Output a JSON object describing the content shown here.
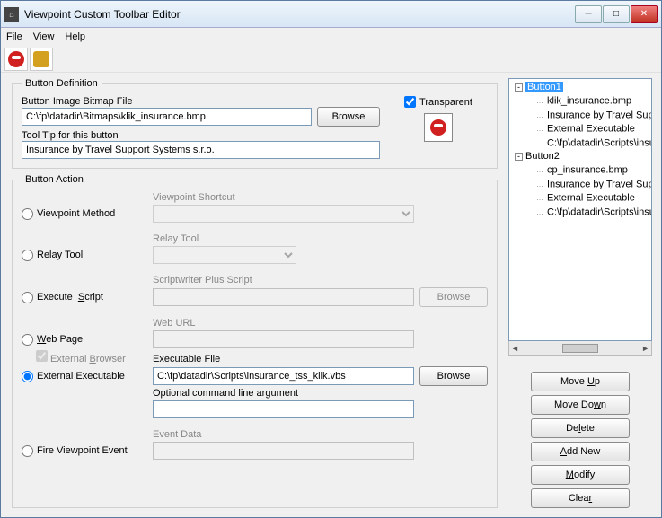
{
  "window": {
    "title": "Viewpoint Custom Toolbar Editor"
  },
  "menu": {
    "file": "File",
    "view": "View",
    "help": "Help"
  },
  "definition": {
    "legend": "Button Definition",
    "bitmap_label": "Button Image Bitmap File",
    "bitmap_value": "C:\\fp\\datadir\\Bitmaps\\klik_insurance.bmp",
    "browse": "Browse",
    "transparent_label": "Transparent",
    "transparent_checked": true,
    "tooltip_label": "Tool Tip for this button",
    "tooltip_value": "Insurance by Travel Support Systems s.r.o."
  },
  "action": {
    "legend": "Button Action",
    "viewpoint_method": "Viewpoint Method",
    "viewpoint_shortcut_label": "Viewpoint Shortcut",
    "relay_tool": "Relay Tool",
    "relay_tool_label": "Relay Tool",
    "execute_script": "Execute  Script",
    "script_label": "Scriptwriter Plus Script",
    "script_browse": "Browse",
    "web_page": "Web Page",
    "web_url_label": "Web URL",
    "external_browser": "External Browser",
    "external_executable": "External Executable",
    "exe_label": "Executable File",
    "exe_value": "C:\\fp\\datadir\\Scripts\\insurance_tss_klik.vbs",
    "exe_browse": "Browse",
    "optional_arg_label": "Optional command line argument",
    "optional_arg_value": "",
    "fire_event": "Fire Viewpoint Event",
    "event_data_label": "Event Data",
    "selected": "external_executable"
  },
  "tree": {
    "items": [
      {
        "label": "Button1",
        "selected": true,
        "children": [
          "klik_insurance.bmp",
          "Insurance by Travel Support Systems s.r.o.",
          "External Executable",
          "C:\\fp\\datadir\\Scripts\\insurance_tss_klik.vbs"
        ]
      },
      {
        "label": "Button2",
        "selected": false,
        "children": [
          "cp_insurance.bmp",
          "Insurance by Travel Support Systems s.r.o.",
          "External Executable",
          "C:\\fp\\datadir\\Scripts\\insurance_tss_klik.vbs"
        ]
      }
    ]
  },
  "buttons": {
    "move_up": "Move Up",
    "move_down": "Move Down",
    "delete": "Delete",
    "add_new": "Add New",
    "modify": "Modify",
    "clear": "Clear"
  }
}
